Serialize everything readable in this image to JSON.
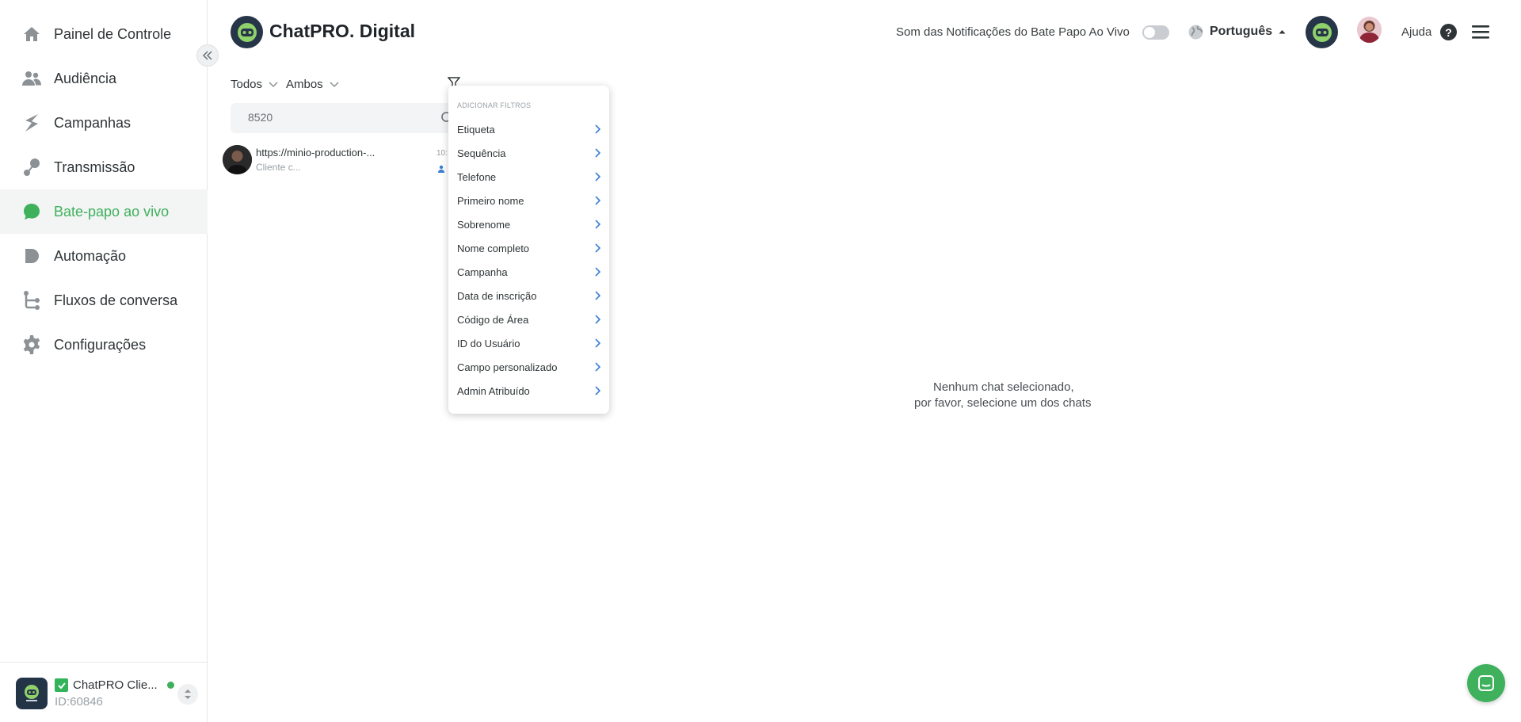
{
  "sidebar": {
    "items": [
      {
        "label": "Painel de Controle",
        "icon": "home-icon"
      },
      {
        "label": "Audiência",
        "icon": "users-icon"
      },
      {
        "label": "Campanhas",
        "icon": "campaigns-icon"
      },
      {
        "label": "Transmissão",
        "icon": "broadcast-icon"
      },
      {
        "label": "Bate-papo ao vivo",
        "icon": "chat-bubble-icon",
        "active": true
      },
      {
        "label": "Automação",
        "icon": "automation-icon"
      },
      {
        "label": "Fluxos de conversa",
        "icon": "flow-icon"
      },
      {
        "label": "Configurações",
        "icon": "gear-icon"
      }
    ],
    "account": {
      "name": "ChatPRO Clie...",
      "id": "ID:60846"
    }
  },
  "header": {
    "brand": "ChatPRO. Digital",
    "notifications_label": "Som das Notificações do Bate Papo Ao Vivo",
    "language": "Português",
    "help_label": "Ajuda"
  },
  "chat_list": {
    "filter_status": "Todos",
    "filter_channel": "Ambos",
    "search_value": "8520",
    "items": [
      {
        "title": "https://minio-production-...",
        "subtitle": "Cliente c...",
        "time": "10:"
      }
    ]
  },
  "filter_menu": {
    "heading": "ADICIONAR FILTROS",
    "items": [
      "Etiqueta",
      "Sequência",
      "Telefone",
      "Primeiro nome",
      "Sobrenome",
      "Nome completo",
      "Campanha",
      "Data de inscrição",
      "Código de Área",
      "ID do Usuário",
      "Campo personalizado",
      "Admin Atribuído"
    ]
  },
  "empty_state": {
    "line1": "Nenhum chat selecionado,",
    "line2": "por favor, selecione um dos chats"
  },
  "colors": {
    "accent": "#3fb15d",
    "nav_icon": "#8c9196"
  }
}
